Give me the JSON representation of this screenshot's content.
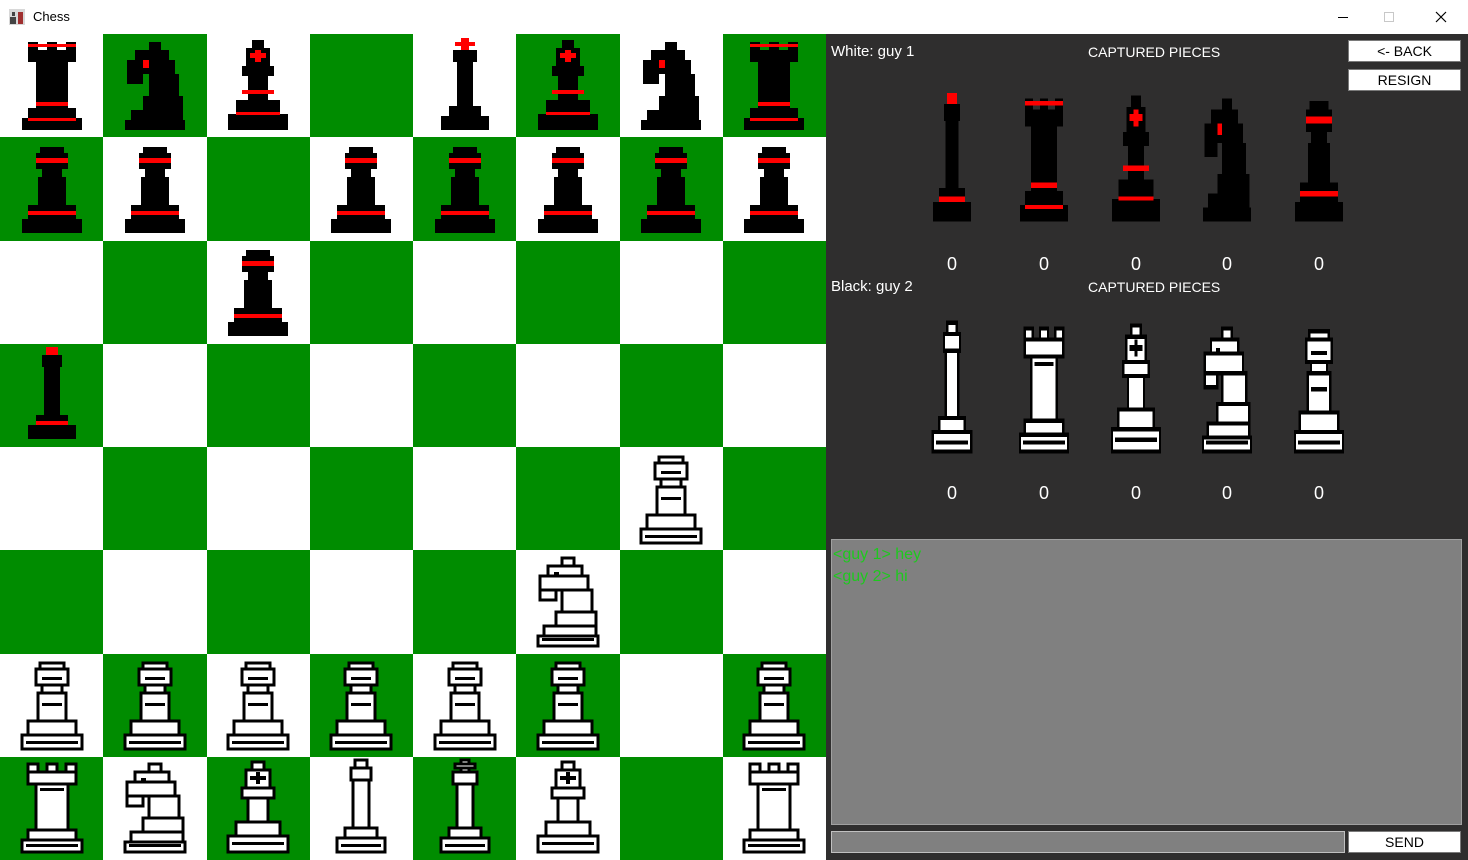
{
  "window": {
    "title": "Chess",
    "controls": [
      "minimize",
      "maximize",
      "close"
    ]
  },
  "colors": {
    "light_square": "#ffffff",
    "dark_square": "#008c00",
    "panel_bg": "#2f2e2e",
    "chat_bg": "#808080",
    "chat_text": "#1ec81e",
    "accent_red": "#ff0000"
  },
  "board": {
    "rows": [
      [
        "black-rook",
        "black-knight",
        "black-bishop",
        "",
        "black-king",
        "black-bishop",
        "black-knight",
        "black-rook"
      ],
      [
        "black-pawn",
        "black-pawn",
        "",
        "black-pawn",
        "black-pawn",
        "black-pawn",
        "black-pawn",
        "black-pawn"
      ],
      [
        "",
        "",
        "black-pawn",
        "",
        "",
        "",
        "",
        ""
      ],
      [
        "black-queen",
        "",
        "",
        "",
        "",
        "",
        "",
        ""
      ],
      [
        "",
        "",
        "",
        "",
        "",
        "",
        "white-pawn",
        ""
      ],
      [
        "",
        "",
        "",
        "",
        "",
        "white-knight",
        "",
        ""
      ],
      [
        "white-pawn",
        "white-pawn",
        "white-pawn",
        "white-pawn",
        "white-pawn",
        "white-pawn",
        "",
        "white-pawn"
      ],
      [
        "white-rook",
        "white-knight",
        "white-bishop",
        "white-queen",
        "white-king",
        "white-bishop",
        "",
        "white-rook"
      ]
    ]
  },
  "white_player": {
    "label": "White: guy 1",
    "captured_title": "CAPTURED PIECES",
    "captured": [
      {
        "piece": "black-queen",
        "count": "0"
      },
      {
        "piece": "black-rook",
        "count": "0"
      },
      {
        "piece": "black-bishop",
        "count": "0"
      },
      {
        "piece": "black-knight",
        "count": "0"
      },
      {
        "piece": "black-pawn",
        "count": "0"
      }
    ]
  },
  "black_player": {
    "label": "Black: guy 2",
    "captured_title": "CAPTURED PIECES",
    "captured": [
      {
        "piece": "white-queen",
        "count": "0"
      },
      {
        "piece": "white-rook",
        "count": "0"
      },
      {
        "piece": "white-bishop",
        "count": "0"
      },
      {
        "piece": "white-knight",
        "count": "0"
      },
      {
        "piece": "white-pawn",
        "count": "0"
      }
    ]
  },
  "buttons": {
    "back": "<- BACK",
    "resign": "RESIGN",
    "send": "SEND"
  },
  "chat": {
    "messages": [
      "<guy 1> hey",
      "<guy 2> hi"
    ],
    "input_value": ""
  }
}
